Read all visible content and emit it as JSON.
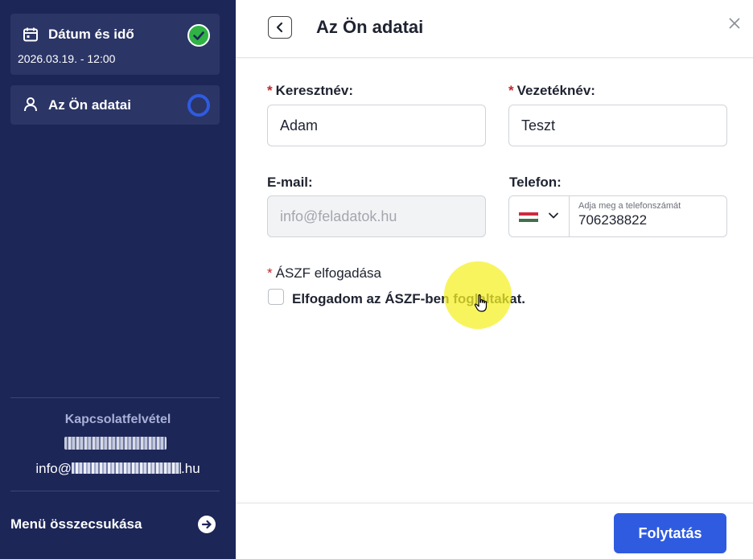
{
  "sidebar": {
    "steps": [
      {
        "title": "Dátum és idő",
        "subtitle": "2026.03.19. - 12:00",
        "icon": "calendar-icon",
        "status": "completed"
      },
      {
        "title": "Az Ön adatai",
        "icon": "user-icon",
        "status": "active"
      }
    ],
    "contact": {
      "title": "Kapcsolatfelvétel",
      "email_prefix": "info@",
      "email_suffix": ".hu"
    },
    "collapse_label": "Menü összecsukása"
  },
  "header": {
    "title": "Az Ön adatai"
  },
  "form": {
    "required_mark": "*",
    "first_name": {
      "label": "Keresztnév:",
      "value": "Adam"
    },
    "last_name": {
      "label": "Vezetéknév:",
      "value": "Teszt"
    },
    "email": {
      "label": "E-mail:",
      "placeholder": "info@feladatok.hu"
    },
    "phone": {
      "label": "Telefon:",
      "floating_label": "Adja meg a telefonszámát",
      "value": "706238822",
      "country_flag": "flag-hu-icon"
    },
    "terms": {
      "label": "ÁSZF elfogadása",
      "checkbox_label": "Elfogadom az ÁSZF-ben foglaltakat.",
      "checked": false
    }
  },
  "footer": {
    "continue_label": "Folytatás"
  },
  "colors": {
    "sidebar_bg": "#1c2657",
    "step_bg": "#2b3566",
    "accent": "#2f5be0",
    "success": "#2fb344",
    "required": "#c0262d"
  }
}
